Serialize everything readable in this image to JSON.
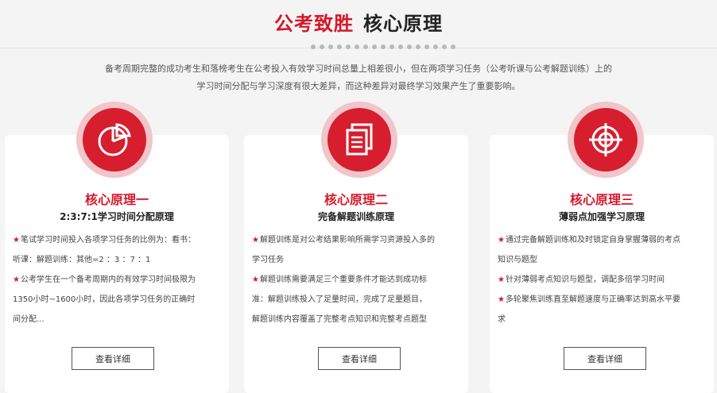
{
  "header": {
    "title_red": "公考致胜",
    "title_dark": "核心原理",
    "intro_line1": "备考周期完整的成功考生和落榜考生在公考投入有效学习时间总量上相差很小，但在两项学习任务（公考听课与公考解题训练）上的",
    "intro_line2": "学习时间分配与学习深度有很大差异，而这种差异对最终学习效果产生了重要影响。"
  },
  "cards": [
    {
      "icon": "pie-chart-icon",
      "title": "核心原理一",
      "subtitle": "2:3:7:1学习时间分配原理",
      "items": [
        "笔试学习时间投入各项学习任务的比例为：看书：",
        "听课：解题训练：其他=2 ：3 ：7 ：1",
        "公考学生在一个备考周期内的有效学习时间极限为",
        "1350小时~1600小时，因此各项学习任务的正确时",
        "间分配..."
      ],
      "button": "查看详细"
    },
    {
      "icon": "documents-icon",
      "title": "核心原理二",
      "subtitle": "完备解题训练原理",
      "items": [
        "解题训练是对公考结果影响所需学习资源投入多的",
        "学习任务",
        "解题训练需要满足三个重要条件才能达到成功标",
        "准：解题训练投入了足量时间，完成了足量题目，",
        "解题训练内容覆盖了完整考点知识和完整考点题型"
      ],
      "button": "查看详细"
    },
    {
      "icon": "target-icon",
      "title": "核心原理三",
      "subtitle": "薄弱点加强学习原理",
      "items": [
        "通过完备解题训练和及时锁定自身掌握薄弱的考点",
        "知识与题型",
        "针对薄弱考点知识与题型，调配多倍学习时间",
        "多轮聚焦训练直至解题速度与正确率达到高水平要",
        "求"
      ],
      "button": "查看详细"
    }
  ],
  "colors": {
    "accent": "#d6172a",
    "icon_ring": "#f1c5ca"
  }
}
